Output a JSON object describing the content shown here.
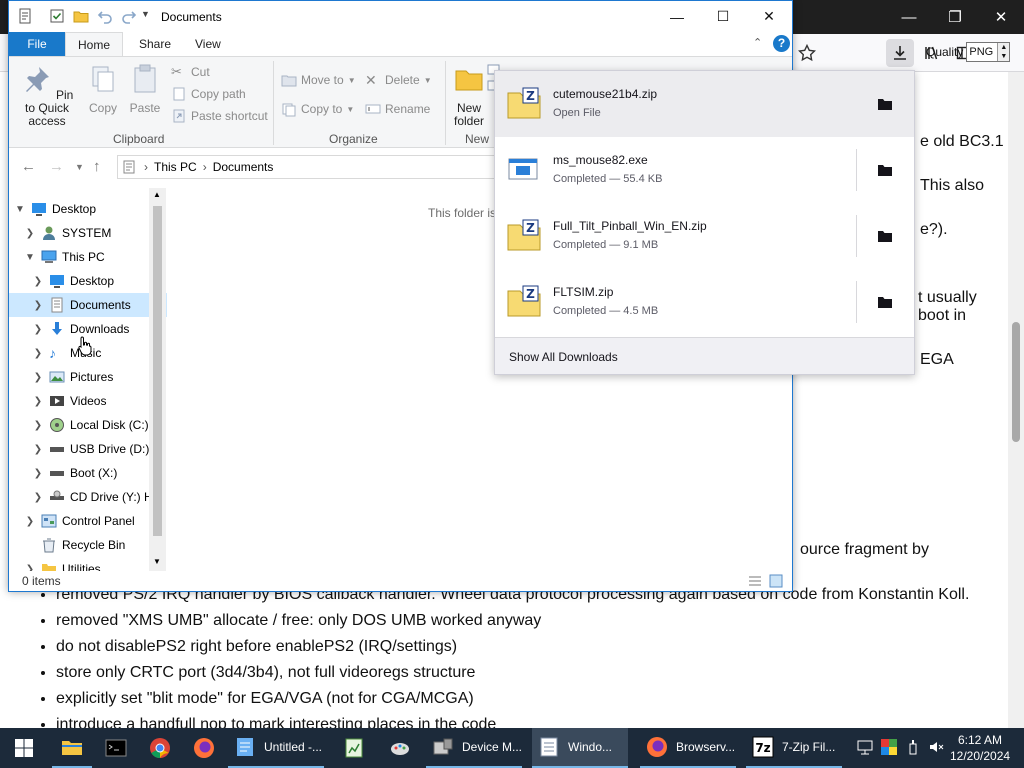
{
  "explorer": {
    "title": "Documents",
    "tabs": [
      "File",
      "Home",
      "Share",
      "View"
    ],
    "clipboard": {
      "pin": "Pin to Quick access",
      "copy": "Copy",
      "paste": "Paste",
      "cut": "Cut",
      "copy_path": "Copy path",
      "paste_shortcut": "Paste shortcut",
      "group": "Clipboard"
    },
    "organize": {
      "move_to": "Move to",
      "copy_to": "Copy to",
      "delete": "Delete",
      "rename": "Rename",
      "group": "Organize"
    },
    "new": {
      "new_folder": "New folder",
      "group": "New"
    },
    "breadcrumb": [
      "This PC",
      "Documents"
    ],
    "tree": [
      {
        "label": "Desktop",
        "icon": "desktop-icon"
      },
      {
        "label": "SYSTEM",
        "icon": "user-icon"
      },
      {
        "label": "This PC",
        "icon": "computer-icon"
      },
      {
        "label": "Desktop",
        "icon": "desktop-icon"
      },
      {
        "label": "Documents",
        "icon": "documents-icon"
      },
      {
        "label": "Downloads",
        "icon": "downloads-icon"
      },
      {
        "label": "Music",
        "icon": "music-icon"
      },
      {
        "label": "Pictures",
        "icon": "pictures-icon"
      },
      {
        "label": "Videos",
        "icon": "videos-icon"
      },
      {
        "label": "Local Disk (C:)",
        "icon": "disk-icon"
      },
      {
        "label": "USB Drive (D:)",
        "icon": "usb-drive-icon"
      },
      {
        "label": "Boot (X:)",
        "icon": "drive-icon"
      },
      {
        "label": "CD Drive (Y:) H",
        "icon": "cd-drive-icon"
      },
      {
        "label": "Control Panel",
        "icon": "control-panel-icon"
      },
      {
        "label": "Recycle Bin",
        "icon": "recycle-bin-icon"
      },
      {
        "label": "Utilities",
        "icon": "folder-icon"
      }
    ],
    "empty_message": "This folder is",
    "status": "0 items"
  },
  "downloads": {
    "items": [
      {
        "name": "cutemouse21b4.zip",
        "status": "Open File"
      },
      {
        "name": "ms_mouse82.exe",
        "status": "Completed — 55.4 KB"
      },
      {
        "name": "Full_Tilt_Pinball_Win_EN.zip",
        "status": "Completed — 9.1 MB"
      },
      {
        "name": "FLTSIM.zip",
        "status": "Completed — 4.5 MB"
      }
    ],
    "show_all": "Show All Downloads"
  },
  "browser": {
    "quality_label": "Quality",
    "quality_value": "PNG",
    "fragments": [
      "e old BC3.1",
      "This also",
      "e?).",
      "t usually",
      "boot in",
      "EGA",
      "ource fragment by"
    ],
    "bullets": [
      "removed PS/2 IRQ handler by BIOS callback handler. Wheel data protocol processing again based on code from Konstantin Koll.",
      "removed \"XMS UMB\" allocate / free: only DOS UMB worked anyway",
      "do not disablePS2 right before enablePS2 (IRQ/settings)",
      "store only CRTC port (3d4/3b4), not full videoregs structure",
      "explicitly set \"blit mode\" for EGA/VGA (not for CGA/MCGA)",
      "introduce a handfull nop to mark interesting places in the code"
    ]
  },
  "taskbar": {
    "apps": [
      {
        "label": "Untitled -...",
        "icon": "notepad-icon"
      },
      {
        "label": "Device M...",
        "icon": "device-manager-icon"
      },
      {
        "label": "Windo...",
        "icon": "explorer-window-icon"
      },
      {
        "label": "Browserv...",
        "icon": "firefox-icon"
      },
      {
        "label": "7-Zip Fil...",
        "icon": "7zip-icon"
      }
    ],
    "time": "6:12 AM",
    "date": "12/20/2024"
  }
}
